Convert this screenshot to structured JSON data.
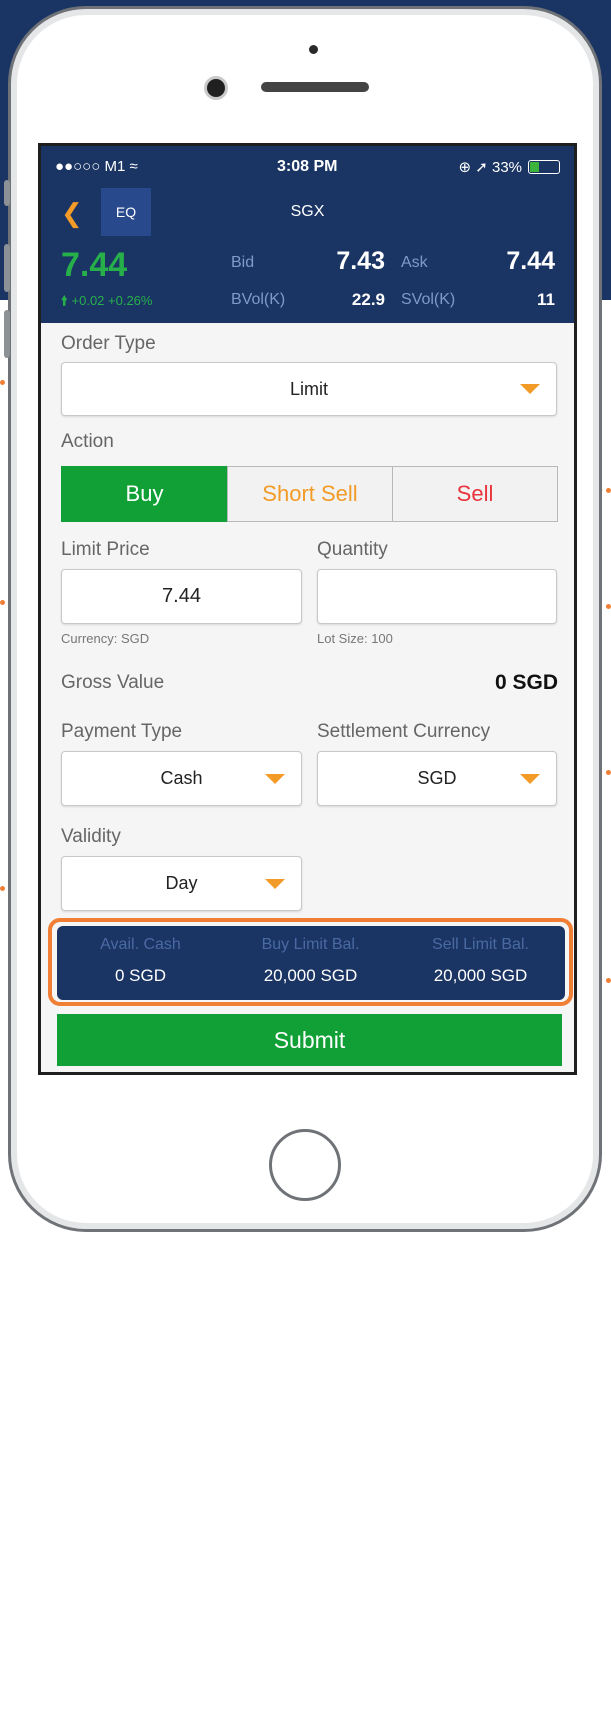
{
  "status_bar": {
    "carrier": "●●○○○ M1 ≈",
    "time": "3:08 PM",
    "battery_text": "⊕ ➚ 33%",
    "battery_level": 0.33
  },
  "header": {
    "market_badge": "EQ",
    "symbol": "SGX",
    "last_price": "7.44",
    "change": "+0.02 +0.26%",
    "bid_label": "Bid",
    "bid_value": "7.43",
    "ask_label": "Ask",
    "ask_value": "7.44",
    "bvol_label": "BVol(K)",
    "bvol_value": "22.9",
    "svol_label": "SVol(K)",
    "svol_value": "11"
  },
  "form": {
    "order_type_label": "Order Type",
    "order_type_value": "Limit",
    "action_label": "Action",
    "actions": [
      "Buy",
      "Short Sell",
      "Sell"
    ],
    "selected_action": "Buy",
    "limit_price_label": "Limit Price",
    "limit_price_value": "7.44",
    "quantity_label": "Quantity",
    "quantity_value": "",
    "currency_note": "Currency: SGD",
    "lot_size_note": "Lot Size: 100",
    "gross_value_label": "Gross Value",
    "gross_value": "0 SGD",
    "payment_type_label": "Payment Type",
    "payment_type_value": "Cash",
    "settlement_currency_label": "Settlement Currency",
    "settlement_currency_value": "SGD",
    "validity_label": "Validity",
    "validity_value": "Day"
  },
  "balances": {
    "avail_cash_label": "Avail. Cash",
    "avail_cash_value": "0 SGD",
    "buy_limit_label": "Buy Limit Bal.",
    "buy_limit_value": "20,000 SGD",
    "sell_limit_label": "Sell Limit Bal.",
    "sell_limit_value": "20,000 SGD"
  },
  "submit_label": "Submit",
  "colors": {
    "navy": "#1a3464",
    "accent_orange": "#f39b27",
    "buy_green": "#11a035",
    "price_green": "#27b04a",
    "sell_red": "#e8343c",
    "highlight_orange": "#f07f35"
  }
}
